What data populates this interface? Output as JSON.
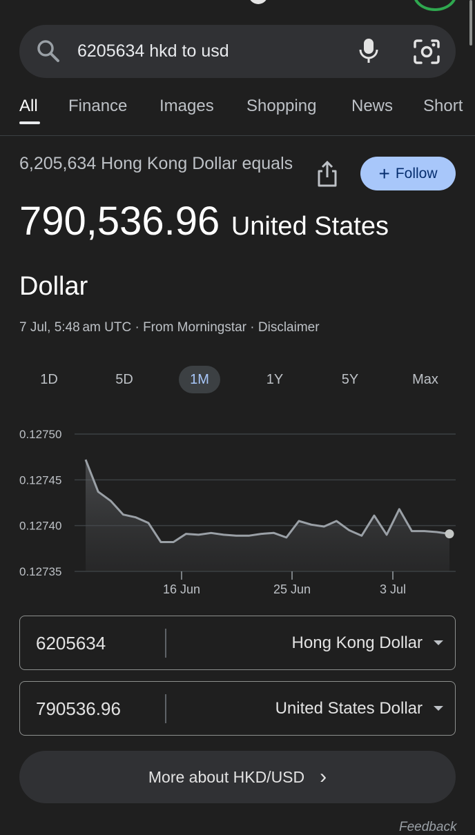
{
  "search": {
    "query": "6205634 hkd to usd"
  },
  "tabs": [
    "All",
    "Finance",
    "Images",
    "Shopping",
    "News",
    "Short"
  ],
  "result": {
    "from_line": "6,205,634 Hong Kong Dollar equals",
    "value": "790,536.96",
    "unit_line1": "United States",
    "unit_line2": "Dollar",
    "meta": "7 Jul, 5:48 am UTC · From Morningstar · Disclaimer",
    "follow_label": "Follow"
  },
  "ranges": [
    "1D",
    "5D",
    "1M",
    "1Y",
    "5Y",
    "Max"
  ],
  "active_range": "1M",
  "chart_data": {
    "type": "area",
    "y_ticks": [
      "0.12750",
      "0.12745",
      "0.12740",
      "0.12735"
    ],
    "ylim": [
      0.12735,
      0.1275
    ],
    "x_ticks": [
      "16 Jun",
      "25 Jun",
      "3 Jul"
    ],
    "values": [
      0.127472,
      0.127437,
      0.127427,
      0.127412,
      0.127409,
      0.127403,
      0.127382,
      0.127382,
      0.127391,
      0.12739,
      0.127392,
      0.12739,
      0.127389,
      0.127389,
      0.127391,
      0.127392,
      0.127387,
      0.127405,
      0.127401,
      0.127399,
      0.127405,
      0.127395,
      0.127389,
      0.127411,
      0.12739,
      0.127418,
      0.127394,
      0.127394,
      0.127393,
      0.127391
    ],
    "line_color": "#9aa0a6",
    "grid": true
  },
  "converter": {
    "from": {
      "value": "6205634",
      "currency": "Hong Kong Dollar"
    },
    "to": {
      "value": "790536.96",
      "currency": "United States Dollar"
    }
  },
  "more_button": "More about HKD/USD",
  "feedback": "Feedback"
}
